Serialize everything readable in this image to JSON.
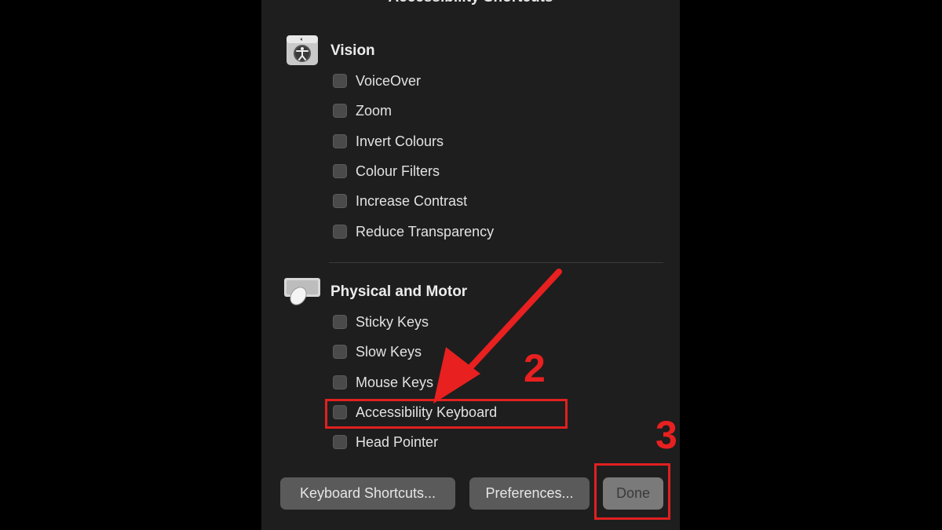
{
  "dialog": {
    "title": "Accessibility Shortcuts",
    "sections": [
      {
        "title": "Vision",
        "icon": "accessibility-person-icon",
        "items": [
          "VoiceOver",
          "Zoom",
          "Invert Colours",
          "Colour Filters",
          "Increase Contrast",
          "Reduce Transparency"
        ]
      },
      {
        "title": "Physical and Motor",
        "icon": "keyboard-mouse-icon",
        "items": [
          "Sticky Keys",
          "Slow Keys",
          "Mouse Keys",
          "Accessibility Keyboard",
          "Head Pointer"
        ]
      }
    ],
    "buttons": {
      "keyboard_shortcuts": "Keyboard Shortcuts...",
      "preferences": "Preferences...",
      "done": "Done"
    }
  },
  "annotations": {
    "step_2": "2",
    "step_3": "3",
    "color": "#e02020"
  }
}
